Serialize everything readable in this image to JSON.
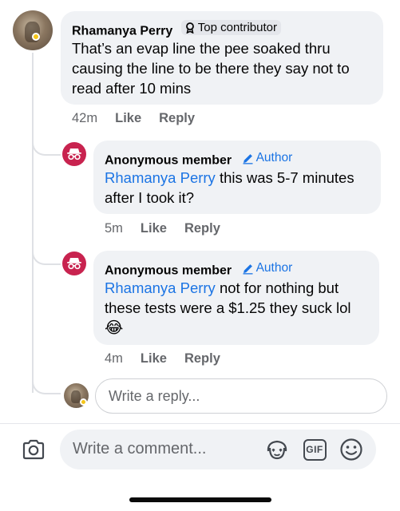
{
  "comments": [
    {
      "author": "Rhamanya Perry",
      "badge": "Top contributor",
      "text": "That’s an evap line the pee soaked thru causing the line to be there they say not to read after 10 mins",
      "time": "42m",
      "like_label": "Like",
      "reply_label": "Reply"
    }
  ],
  "replies": [
    {
      "author": "Anonymous member",
      "badge": "Author",
      "mention": "Rhamanya Perry",
      "text": " this was 5-7 minutes after I took it?",
      "time": "5m",
      "like_label": "Like",
      "reply_label": "Reply"
    },
    {
      "author": "Anonymous member",
      "badge": "Author",
      "mention": "Rhamanya Perry",
      "text": " not for nothing but these tests were a $1.25 they suck lol",
      "emoji": "😂",
      "time": "4m",
      "like_label": "Like",
      "reply_label": "Reply"
    }
  ],
  "reply_box": {
    "placeholder": "Write a reply..."
  },
  "composer": {
    "placeholder": "Write a comment...",
    "gif_label": "GIF"
  },
  "colors": {
    "accent": "#1b74e4",
    "anon_avatar": "#c8234f",
    "bubble": "#f0f2f5"
  }
}
